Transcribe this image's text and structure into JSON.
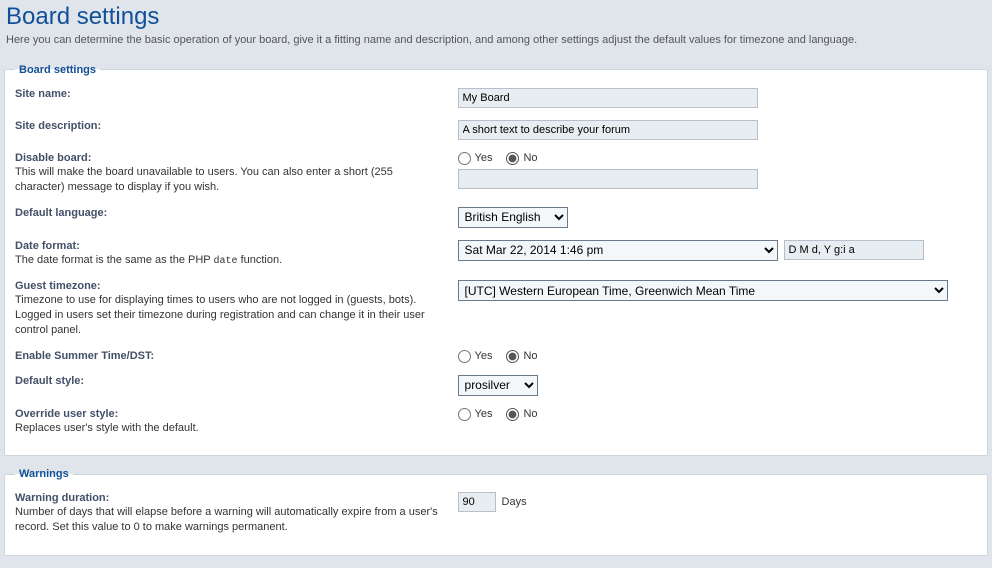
{
  "header": {
    "title": "Board settings",
    "description": "Here you can determine the basic operation of your board, give it a fitting name and description, and among other settings adjust the default values for timezone and language."
  },
  "fieldset_board": {
    "legend": "Board settings",
    "site_name": {
      "label": "Site name:",
      "value": "My Board"
    },
    "site_desc": {
      "label": "Site description:",
      "value": "A short text to describe your forum"
    },
    "disable_board": {
      "label": "Disable board:",
      "hint": "This will make the board unavailable to users. You can also enter a short (255 character) message to display if you wish.",
      "yes": "Yes",
      "no": "No",
      "selected": "no",
      "value": ""
    },
    "default_language": {
      "label": "Default language:",
      "selected": "British English"
    },
    "date_format": {
      "label": "Date format:",
      "hint_prefix": "The date format is the same as the PHP ",
      "hint_code": "date",
      "hint_suffix": " function.",
      "selected": "Sat Mar 22, 2014 1:46 pm",
      "value": "D M d, Y g:i a"
    },
    "guest_timezone": {
      "label": "Guest timezone:",
      "hint": "Timezone to use for displaying times to users who are not logged in (guests, bots). Logged in users set their timezone during registration and can change it in their user control panel.",
      "selected": "[UTC] Western European Time, Greenwich Mean Time"
    },
    "summer_time": {
      "label": "Enable Summer Time/DST:",
      "yes": "Yes",
      "no": "No",
      "selected": "no"
    },
    "default_style": {
      "label": "Default style:",
      "selected": "prosilver"
    },
    "override_style": {
      "label": "Override user style:",
      "hint": "Replaces user's style with the default.",
      "yes": "Yes",
      "no": "No",
      "selected": "no"
    }
  },
  "fieldset_warnings": {
    "legend": "Warnings",
    "warning_duration": {
      "label": "Warning duration:",
      "hint": "Number of days that will elapse before a warning will automatically expire from a user's record. Set this value to 0 to make warnings permanent.",
      "value": "90",
      "unit": "Days"
    }
  }
}
